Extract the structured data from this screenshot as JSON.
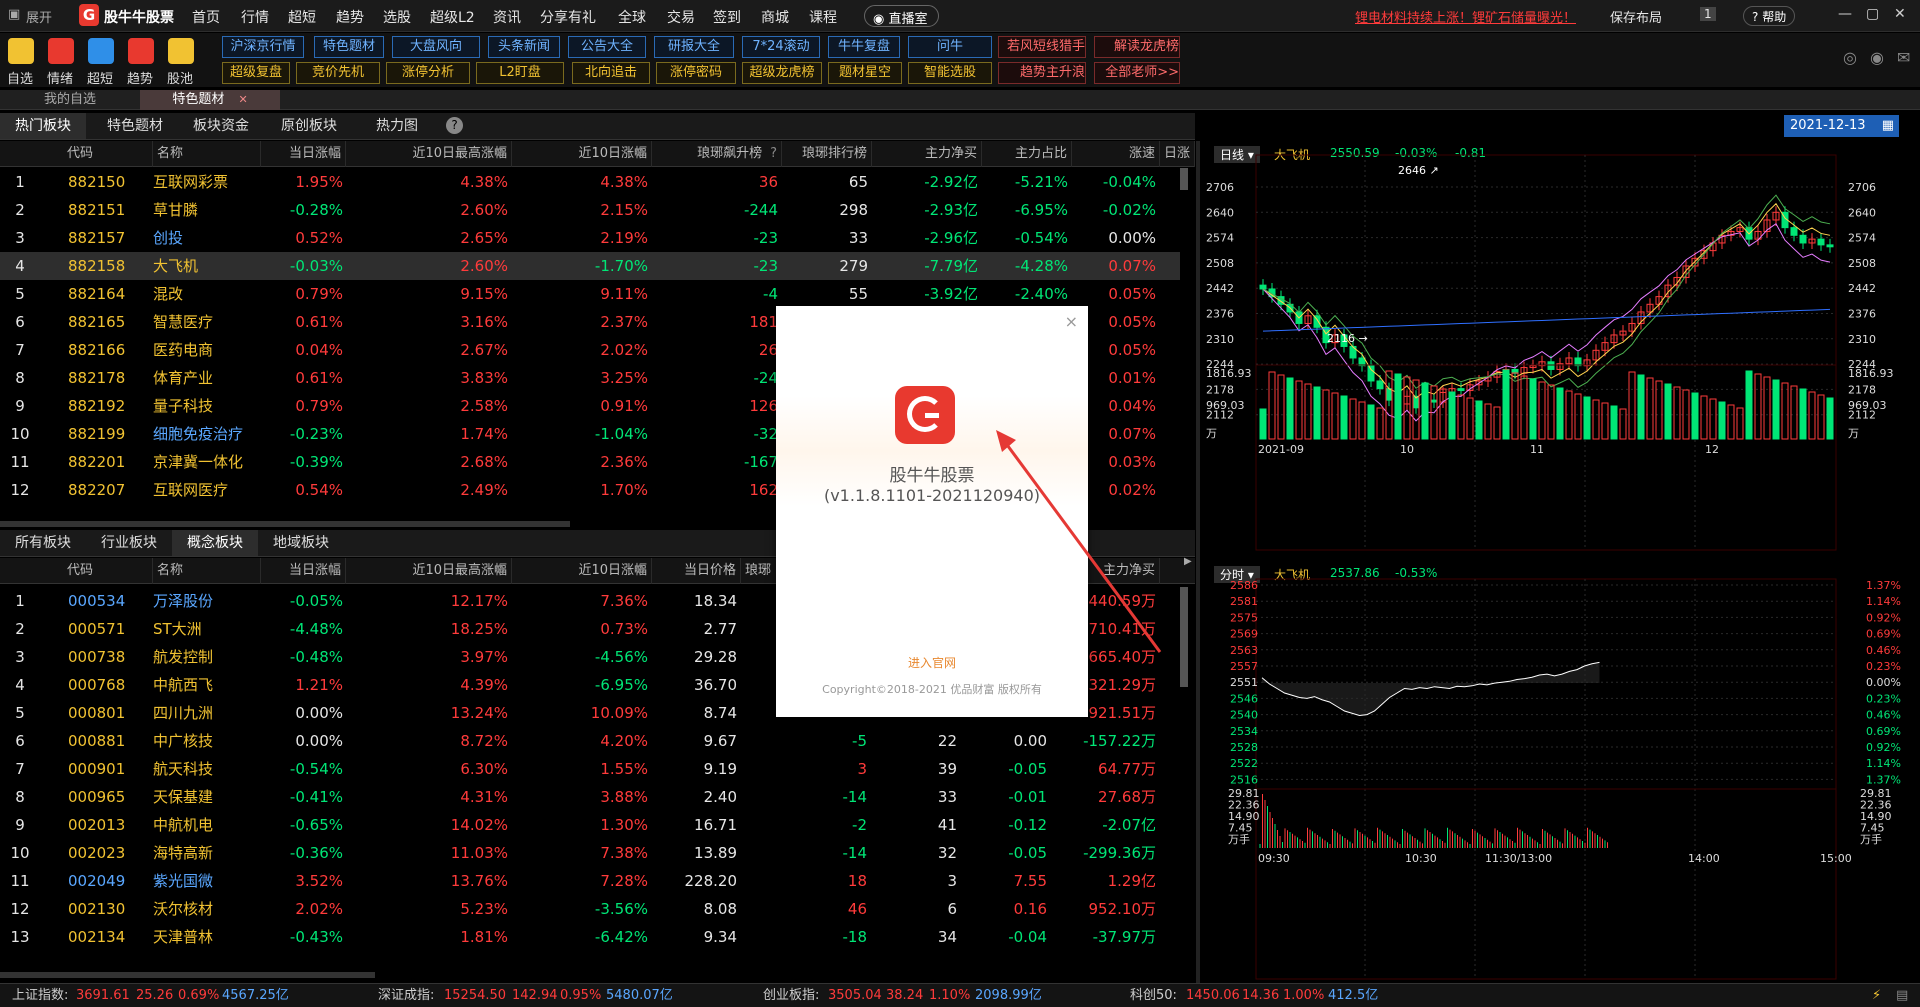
{
  "menubar": {
    "expand": "展开",
    "app_name": "股牛牛股票",
    "items": [
      "首页",
      "行情",
      "超短",
      "趋势",
      "选股",
      "超级L2",
      "资讯",
      "分享有礼",
      "全球",
      "交易",
      "签到",
      "商城",
      "课程"
    ],
    "live_btn": "直播室",
    "ticker": "锂电材料持续上涨！锂矿石储量曝光！",
    "save_layout": "保存布局",
    "badge": "1",
    "help": "帮助",
    "colors": {
      "brand": "#e8392f",
      "accent": "#f1c232",
      "up": "#ff3b3b",
      "down": "#00e676"
    }
  },
  "toolbar": {
    "buttons": [
      {
        "label": "自选",
        "icon": "plus-icon"
      },
      {
        "label": "情绪",
        "icon": "heart-icon"
      },
      {
        "label": "超短",
        "icon": "folder-icon"
      },
      {
        "label": "趋势",
        "icon": "target-icon"
      },
      {
        "label": "股池",
        "icon": "chart-icon"
      }
    ],
    "tags_row1": [
      "沪深京行情",
      "特色题材",
      "大盘风向",
      "头条新闻",
      "公告大全",
      "研报大全",
      "7*24滚动",
      "牛牛复盘",
      "问牛",
      "若风短线猎手",
      "解读龙虎榜"
    ],
    "tags_row2": [
      "超级复盘",
      "竞价先机",
      "涨停分析",
      "L2盯盘",
      "北向追击",
      "涨停密码",
      "超级龙虎榜",
      "题材星空",
      "智能选股",
      "趋势主升浪",
      "全部老师>>"
    ]
  },
  "workspace_tabs": [
    "我的自选",
    "特色题材"
  ],
  "top_section": {
    "tabs": [
      "热门板块",
      "特色题材",
      "板块资金",
      "原创板块",
      "热力图"
    ],
    "date": "2021-12-13",
    "columns": [
      "代码",
      "名称",
      "当日涨幅",
      "近10日最高涨幅",
      "近10日涨幅",
      "琅琊飙升榜",
      "琅琊排行榜",
      "主力净买",
      "主力占比",
      "涨速",
      "日涨"
    ],
    "rows": [
      {
        "n": "1",
        "code": "882150",
        "name": "互联网彩票",
        "chg": "1.95%",
        "max10": "4.38%",
        "chg10": "4.38%",
        "rise": "36",
        "rank": "65",
        "net": "-2.92亿",
        "ratio": "-5.21%",
        "speed": "-0.04%"
      },
      {
        "n": "2",
        "code": "882151",
        "name": "草甘膦",
        "chg": "-0.28%",
        "max10": "2.60%",
        "chg10": "2.15%",
        "rise": "-244",
        "rank": "298",
        "net": "-2.93亿",
        "ratio": "-6.95%",
        "speed": "-0.02%"
      },
      {
        "n": "3",
        "code": "882157",
        "name": "创投",
        "chg": "0.52%",
        "max10": "2.65%",
        "chg10": "2.19%",
        "rise": "-23",
        "rank": "33",
        "net": "-2.96亿",
        "ratio": "-0.54%",
        "speed": "0.00%"
      },
      {
        "n": "4",
        "code": "882158",
        "name": "大飞机",
        "chg": "-0.03%",
        "max10": "2.60%",
        "chg10": "-1.70%",
        "rise": "-23",
        "rank": "279",
        "net": "-7.79亿",
        "ratio": "-4.28%",
        "speed": "0.07%"
      },
      {
        "n": "5",
        "code": "882164",
        "name": "混改",
        "chg": "0.79%",
        "max10": "9.15%",
        "chg10": "9.11%",
        "rise": "-4",
        "rank": "55",
        "net": "-3.92亿",
        "ratio": "-2.40%",
        "speed": "0.05%"
      },
      {
        "n": "6",
        "code": "882165",
        "name": "智慧医疗",
        "chg": "0.61%",
        "max10": "3.16%",
        "chg10": "2.37%",
        "rise": "181",
        "rank": "",
        "net": "",
        "ratio": "",
        "speed": "0.05%"
      },
      {
        "n": "7",
        "code": "882166",
        "name": "医药电商",
        "chg": "0.04%",
        "max10": "2.67%",
        "chg10": "2.02%",
        "rise": "26",
        "rank": "",
        "net": "",
        "ratio": "",
        "speed": "0.05%"
      },
      {
        "n": "8",
        "code": "882178",
        "name": "体育产业",
        "chg": "0.61%",
        "max10": "3.83%",
        "chg10": "3.25%",
        "rise": "-24",
        "rank": "",
        "net": "",
        "ratio": "",
        "speed": "0.01%"
      },
      {
        "n": "9",
        "code": "882192",
        "name": "量子科技",
        "chg": "0.79%",
        "max10": "2.58%",
        "chg10": "0.91%",
        "rise": "126",
        "rank": "",
        "net": "",
        "ratio": "",
        "speed": "0.04%"
      },
      {
        "n": "10",
        "code": "882199",
        "name": "细胞免疫治疗",
        "chg": "-0.23%",
        "max10": "1.74%",
        "chg10": "-1.04%",
        "rise": "-32",
        "rank": "",
        "net": "",
        "ratio": "",
        "speed": "0.07%"
      },
      {
        "n": "11",
        "code": "882201",
        "name": "京津冀一体化",
        "chg": "-0.39%",
        "max10": "2.68%",
        "chg10": "2.36%",
        "rise": "-167",
        "rank": "",
        "net": "",
        "ratio": "",
        "speed": "0.03%"
      },
      {
        "n": "12",
        "code": "882207",
        "name": "互联网医疗",
        "chg": "0.54%",
        "max10": "2.49%",
        "chg10": "1.70%",
        "rise": "162",
        "rank": "",
        "net": "",
        "ratio": "",
        "speed": "0.02%"
      }
    ]
  },
  "bottom_section": {
    "tabs": [
      "所有板块",
      "行业板块",
      "概念板块",
      "地域板块"
    ],
    "columns": [
      "代码",
      "名称",
      "当日涨幅",
      "近10日最高涨幅",
      "近10日涨幅",
      "当日价格",
      "琅琊",
      "",
      "",
      "主力净买"
    ],
    "rows": [
      {
        "n": "1",
        "code": "000534",
        "name": "万泽股份",
        "chg": "-0.05%",
        "max10": "12.17%",
        "chg10": "7.36%",
        "price": "18.34",
        "a": "",
        "b": "",
        "c": "",
        "net": "440.59万"
      },
      {
        "n": "2",
        "code": "000571",
        "name": "ST大洲",
        "chg": "-4.48%",
        "max10": "18.25%",
        "chg10": "0.73%",
        "price": "2.77",
        "a": "",
        "b": "",
        "c": "",
        "net": "710.41万"
      },
      {
        "n": "3",
        "code": "000738",
        "name": "航发控制",
        "chg": "-0.48%",
        "max10": "3.97%",
        "chg10": "-4.56%",
        "price": "29.28",
        "a": "",
        "b": "",
        "c": "",
        "net": "665.40万"
      },
      {
        "n": "4",
        "code": "000768",
        "name": "中航西飞",
        "chg": "1.21%",
        "max10": "4.39%",
        "chg10": "-6.95%",
        "price": "36.70",
        "a": "",
        "b": "",
        "c": "",
        "net": "321.29万"
      },
      {
        "n": "5",
        "code": "000801",
        "name": "四川九洲",
        "chg": "0.00%",
        "max10": "13.24%",
        "chg10": "10.09%",
        "price": "8.74",
        "a": "",
        "b": "",
        "c": "",
        "net": "921.51万"
      },
      {
        "n": "6",
        "code": "000881",
        "name": "中广核技",
        "chg": "0.00%",
        "max10": "8.72%",
        "chg10": "4.20%",
        "price": "9.67",
        "a": "-5",
        "b": "22",
        "c": "0.00",
        "net": "-157.22万"
      },
      {
        "n": "7",
        "code": "000901",
        "name": "航天科技",
        "chg": "-0.54%",
        "max10": "6.30%",
        "chg10": "1.55%",
        "price": "9.19",
        "a": "3",
        "b": "39",
        "c": "-0.05",
        "net": "64.77万"
      },
      {
        "n": "8",
        "code": "000965",
        "name": "天保基建",
        "chg": "-0.41%",
        "max10": "4.31%",
        "chg10": "3.88%",
        "price": "2.40",
        "a": "-14",
        "b": "33",
        "c": "-0.01",
        "net": "27.68万"
      },
      {
        "n": "9",
        "code": "002013",
        "name": "中航机电",
        "chg": "-0.65%",
        "max10": "14.02%",
        "chg10": "1.30%",
        "price": "16.71",
        "a": "-2",
        "b": "41",
        "c": "-0.12",
        "net": "-2.07亿"
      },
      {
        "n": "10",
        "code": "002023",
        "name": "海特高新",
        "chg": "-0.36%",
        "max10": "11.03%",
        "chg10": "7.38%",
        "price": "13.89",
        "a": "-14",
        "b": "32",
        "c": "-0.05",
        "net": "-299.36万"
      },
      {
        "n": "11",
        "code": "002049",
        "name": "紫光国微",
        "chg": "3.52%",
        "max10": "13.76%",
        "chg10": "7.28%",
        "price": "228.20",
        "a": "18",
        "b": "3",
        "c": "7.55",
        "net": "1.29亿"
      },
      {
        "n": "12",
        "code": "002130",
        "name": "沃尔核材",
        "chg": "2.02%",
        "max10": "5.23%",
        "chg10": "-3.56%",
        "price": "8.08",
        "a": "46",
        "b": "6",
        "c": "0.16",
        "net": "952.10万"
      },
      {
        "n": "13",
        "code": "002134",
        "name": "天津普林",
        "chg": "-0.43%",
        "max10": "1.81%",
        "chg10": "-6.42%",
        "price": "9.34",
        "a": "-18",
        "b": "34",
        "c": "-0.04",
        "net": "-37.97万"
      }
    ]
  },
  "kline": {
    "period": "日线",
    "name": "大飞机",
    "price": "2550.59",
    "chg": "-0.03%",
    "diff": "-0.81",
    "y_labels": [
      "2706",
      "2640",
      "2574",
      "2508",
      "2442",
      "2376",
      "2310",
      "2244",
      "2178",
      "2112"
    ],
    "high_mark": "2646",
    "low_mark": "2116",
    "vol_labels": [
      "1816.93",
      "969.03",
      "万"
    ],
    "x_labels": [
      "2021-09",
      "10",
      "11",
      "12"
    ]
  },
  "intraday": {
    "period": "分时",
    "name": "大飞机",
    "price": "2537.86",
    "chg": "-0.53%",
    "y_left": [
      "2586",
      "2581",
      "2575",
      "2569",
      "2563",
      "2557",
      "2551",
      "2546",
      "2540",
      "2534",
      "2528",
      "2522",
      "2516"
    ],
    "y_right": [
      "1.37%",
      "1.14%",
      "0.92%",
      "0.69%",
      "0.46%",
      "0.23%",
      "0.00%",
      "0.23%",
      "0.46%",
      "0.69%",
      "0.92%",
      "1.14%",
      "1.37%"
    ],
    "vol_left": [
      "29.81",
      "22.36",
      "14.90",
      "7.45",
      "万手"
    ],
    "vol_right": [
      "29.81",
      "22.36",
      "14.90",
      "7.45",
      "万手"
    ],
    "x_labels": [
      "09:30",
      "10:30",
      "11:30/13:00",
      "14:00",
      "15:00"
    ]
  },
  "status": {
    "sh_label": "上证指数:",
    "sh_val": "3691.61",
    "sh_chg": "25.26",
    "sh_pct": "0.69%",
    "sh_amt": "4567.25亿",
    "sz_label": "深证成指:",
    "sz_val": "15254.50",
    "sz_chg": "142.94",
    "sz_pct": "0.95%",
    "sz_amt": "5480.07亿",
    "cy_label": "创业板指:",
    "cy_val": "3505.04",
    "cy_chg": "38.24",
    "cy_pct": "1.10%",
    "cy_amt": "2098.99亿",
    "kc_label": "科创50:",
    "kc_val": "1450.06",
    "kc_chg": "14.36",
    "kc_pct": "1.00%",
    "kc_amt": "412.5亿"
  },
  "dialog": {
    "app_name": "股牛牛股票",
    "version": "(v1.1.8.1101-2021120940)",
    "link": "进入官网",
    "copyright": "Copyright©2018-2021 优品财富 版权所有",
    "close": "×"
  }
}
